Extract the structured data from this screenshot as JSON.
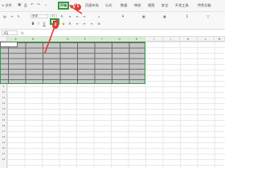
{
  "tabs": {
    "menu": "≡ 文件",
    "home": "开始",
    "insert": "插入",
    "page_layout": "页面布局",
    "formulas": "公式",
    "data": "数据",
    "review": "审阅",
    "view": "视图",
    "security": "安全",
    "dev_tools": "开发工具",
    "special": "特色功能"
  },
  "ribbon": {
    "font_name": "宋体",
    "font_size": "11",
    "bold": "B",
    "italic": "I",
    "underline": "U"
  },
  "formula_bar": {
    "name_box": "A1",
    "fx": "fx"
  },
  "columns": [
    "A",
    "B",
    "C",
    "D",
    "E",
    "F",
    "G",
    "H",
    "I",
    "J",
    "K",
    "L",
    "M"
  ],
  "rows": [
    "1",
    "2",
    "3",
    "4",
    "5",
    "6",
    "7",
    "8",
    "9",
    "10",
    "11",
    "12",
    "13",
    "14",
    "15",
    "16",
    "17",
    "18",
    "19",
    "20",
    "21",
    "22"
  ],
  "callouts": {
    "step1": "1",
    "step2": "2"
  },
  "colors": {
    "accent": "#2e9e3e",
    "callout": "#e53935",
    "selection_fill": "#c7c7c7"
  }
}
